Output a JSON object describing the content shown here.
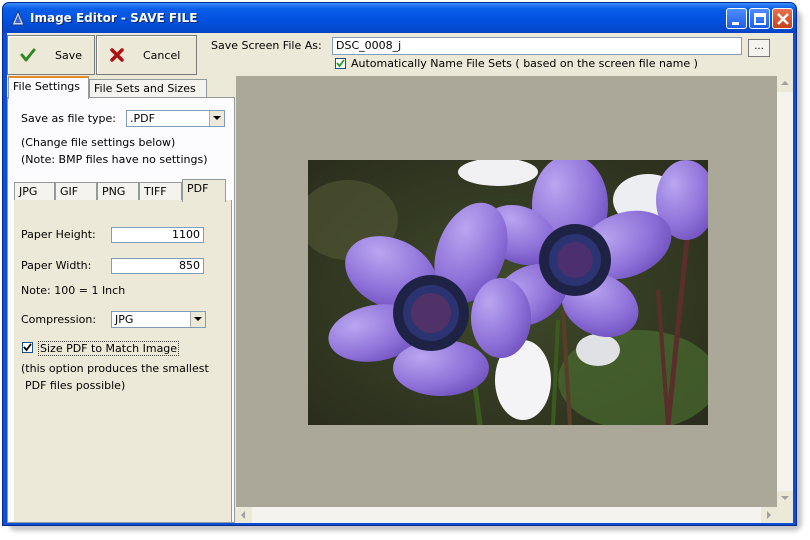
{
  "window": {
    "title": "Image Editor - SAVE FILE",
    "accent": "#0a4fd6"
  },
  "toolbar": {
    "save_label": "Save",
    "cancel_label": "Cancel",
    "save_as_label": "Save Screen File As:",
    "file_name": "DSC_0008_j",
    "browse_label": "...",
    "auto_name_checked": true,
    "auto_name_label": "Automatically Name File Sets ( based on the screen file name )"
  },
  "left_tabs": {
    "file_settings": "File Settings",
    "file_sets": "File Sets and Sizes",
    "active": "File Settings"
  },
  "settings": {
    "file_type_label": "Save as file type:",
    "file_type_value": ".PDF",
    "note_change": "(Change file settings below)",
    "note_bmp": "(Note: BMP files have no settings)"
  },
  "format_tabs": {
    "jpg": "JPG",
    "gif": "GIF",
    "png": "PNG",
    "tiff": "TIFF",
    "pdf": "PDF",
    "active": "PDF"
  },
  "pdf": {
    "height_label": "Paper Height:",
    "height_value": "1100",
    "width_label": "Paper Width:",
    "width_value": "850",
    "inch_note": "Note: 100 = 1 Inch",
    "compression_label": "Compression:",
    "compression_value": "JPG",
    "size_to_image_checked": true,
    "size_to_image_label": "Size PDF to Match Image",
    "option_note_1": "(this option produces the smallest",
    "option_note_2": "PDF files possible)"
  },
  "preview": {
    "background": "#aca899",
    "image_subject": "purple-anemone-flowers"
  }
}
